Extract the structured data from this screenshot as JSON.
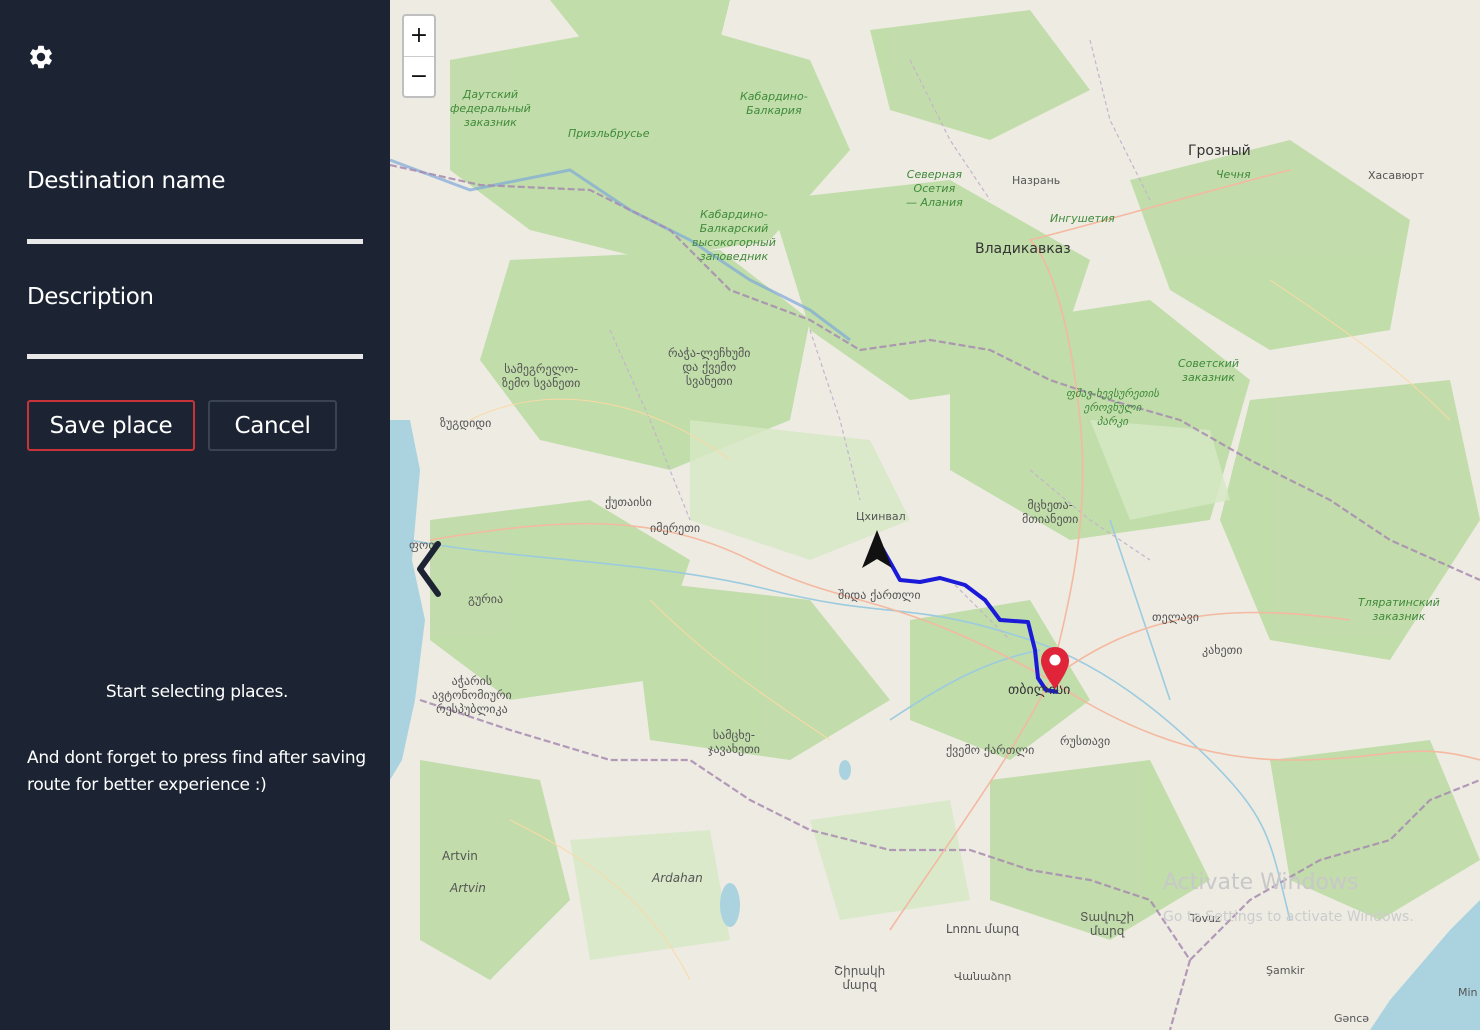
{
  "sidebar": {
    "settings_icon": "gear-icon",
    "destination_label": "Destination name",
    "destination_value": "",
    "description_label": "Description",
    "description_value": "",
    "save_label": "Save place",
    "cancel_label": "Cancel",
    "hint_primary": "Start selecting places.",
    "hint_secondary": "And dont forget to press find after saving route for better experience :)",
    "colors": {
      "background": "#1c2433",
      "save_border": "#c8333a",
      "cancel_border": "#3a4354"
    }
  },
  "map": {
    "zoom_in": "+",
    "zoom_out": "−",
    "collapse_icon": "chevron-left-icon",
    "start_icon": "navigation-arrow-icon",
    "destination_icon": "map-pin-icon",
    "route_color": "#1a1ad8",
    "pin_color": "#e0243a",
    "labels": {
      "daut": "Даутский\nфедеральный\nзаказник",
      "kabbalk": "Кабардино-\nБалкария",
      "prielbrusye": "Приэльбрусье",
      "groznyy": "Грозный",
      "chechnya": "Чечня",
      "khasavyurt": "Хасавюрт",
      "sev_osetia": "Северная\nОсетия\n— Алания",
      "nazran": "Назрань",
      "ingushetia": "Ингушетия",
      "kbvz": "Кабардино-\nБалкарский\nвысокогорный\nзаповедник",
      "vladikavkaz": "Владикавказ",
      "samegrelo": "სამეგრელო-\nზემო სვანეთი",
      "racha": "რაჭა-ლეჩხუმი\nდა ქვემო\nსვანეთი",
      "sovetsky": "Советский\nзаказник",
      "pshav": "ფშავ-ხევსურეთის\nეროვნული\nპარკი",
      "zugdidi": "ზუგდიდი",
      "kutaisi": "ქუთაისი",
      "imereti": "იმერეთი",
      "tskhinval": "Цхинвал",
      "mtskheta": "მცხეთა-\nმთიანეთი",
      "poti": "ფოთ",
      "guria": "გურია",
      "shida": "შიდა ქართლი",
      "telavi": "თელავი",
      "kakheti": "კახეთი",
      "tlyarata": "Тляратинский\nзаказник",
      "adjara": "აჭარის\nავტონომიური\nრესპუბლიკა",
      "tbilisi": "თბილისი",
      "samtskhe": "სამცხე-\nჯავახეთი",
      "kvemo": "ქვემო ქართლი",
      "rustavi": "რუსთავი",
      "artvin1": "Artvin",
      "artvin2": "Artvin",
      "ardahan": "Ardahan",
      "lori": "Լոռու մարզ",
      "syunik": "Տավուշի\nմարզ",
      "shirak": "Շիրակի\nմարզ",
      "vanadzor": "Վանաձոր",
      "tovuz": "Tovuz",
      "shamkir": "Şamkir",
      "ganca": "Gəncə",
      "ming": "Min",
      "activate": "Activate Windows",
      "activate_sub": "Go to Settings to activate Windows."
    }
  }
}
